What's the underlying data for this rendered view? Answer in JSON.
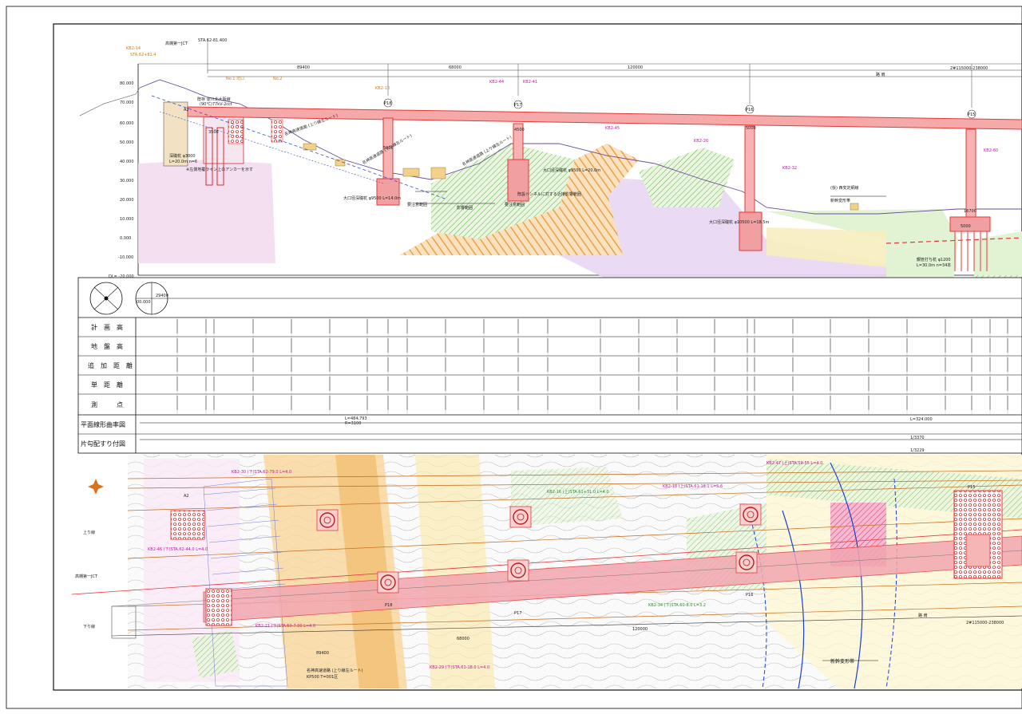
{
  "profile": {
    "elevation_labels": [
      "80.000",
      "70.000",
      "60.000",
      "50.000",
      "40.000",
      "30.000",
      "20.000",
      "10.000",
      "0.000",
      "-10.000",
      "DL= -20.000"
    ],
    "span_dims": [
      "89400",
      "68000",
      "120000"
    ],
    "top_ref_labels": [
      "高槻第一JCT",
      "STA.62-81.400",
      "2#115000-238000",
      "路 肩"
    ],
    "pier_tags": [
      "A2",
      "P18",
      "P17",
      "P16",
      "P15"
    ],
    "notes": [
      {
        "text": "既存 淀川北大阪線"
      },
      {
        "text": "(90℃)77kV-2cct"
      },
      {
        "text": "名神高速道路 (上り線左ルート)"
      },
      {
        "text": "名神高速道路 (下り線左ルート)"
      },
      {
        "text": "名神高速道路 (上り線左ルート)"
      },
      {
        "text": "深礎杭 φ3000"
      },
      {
        "text": "L=20.0m n=6"
      },
      {
        "text": "※左側地覆ライン上のアンカーを示す"
      },
      {
        "text": "大口径深礎杭 φ9500 L=14.0m"
      },
      {
        "text": "大口径深礎杭 φ9500 L=20.0m"
      },
      {
        "text": "既設トンネルに対する近接影響範囲"
      },
      {
        "text": "大口径深礎杭 φ10500 L=18.5m"
      },
      {
        "text": "鋼管打ち杭 φ1200"
      },
      {
        "text": "L=30.0m n=34本"
      },
      {
        "text": "新幹変形帯"
      },
      {
        "text": "(仮) 西安定網線"
      },
      {
        "text": "要注意範囲"
      },
      {
        "text": "影響範囲"
      },
      {
        "text": "要注意範囲"
      }
    ],
    "pier_dims": [
      "3500",
      "5000",
      "4500",
      "5000",
      "5000",
      "16700"
    ]
  },
  "table": {
    "rows": [
      "計　画　高",
      "地　盤　高",
      "追　加　距　離",
      "単　距　離",
      "測　　　点",
      "平面線形曲率図",
      "片勾配すり付図"
    ],
    "curve_labels": [
      "L=484.793",
      "R=3100",
      "L=324.000"
    ],
    "slope_labels": [
      "1/3370",
      "1/3229"
    ],
    "compass": {
      "left": "29400",
      "right": "00.000"
    }
  },
  "plan": {
    "labels": [
      "上り線",
      "高槻第一JCT",
      "下り線",
      "P18",
      "P17",
      "P16",
      "P15",
      "A2",
      "新幹変形帯",
      "路 肩",
      "2#115000-238000",
      "名神高速道路 (上り線左ルート)",
      "KP500 T=001区"
    ],
    "dims": [
      "89400",
      "68000",
      "120000"
    ]
  },
  "colors": {
    "deck": "#e85a6a",
    "deck_fill": "#f4a0a8",
    "soil_orange": "#f2b870",
    "soil_purple": "#e6cdf2",
    "soil_green": "#c7e8b0",
    "soil_yellow": "#f7e9a6",
    "pier": "#e23a3a",
    "fault": "#1a3fd6"
  }
}
